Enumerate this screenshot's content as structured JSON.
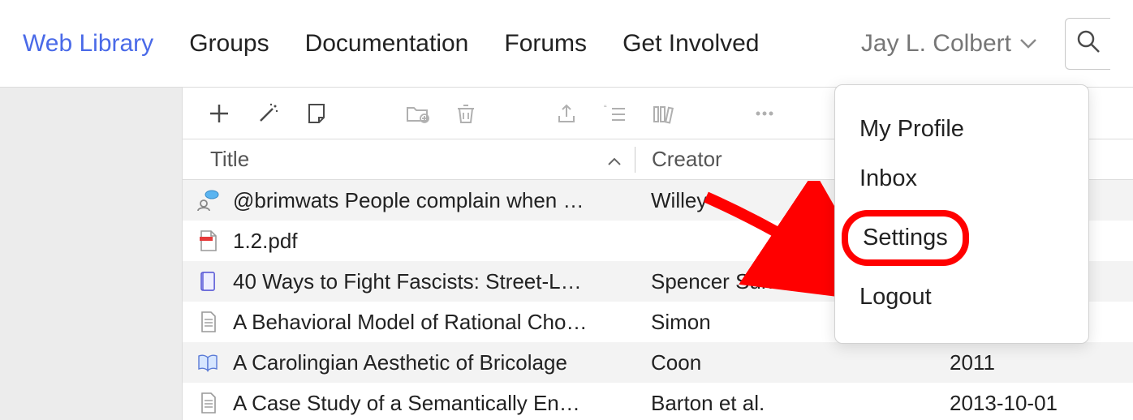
{
  "nav": {
    "links": [
      "Web Library",
      "Groups",
      "Documentation",
      "Forums",
      "Get Involved"
    ],
    "active_index": 0,
    "user_name": "Jay L. Colbert"
  },
  "user_menu": {
    "items": [
      "My Profile",
      "Inbox",
      "Settings",
      "Logout"
    ],
    "highlight_index": 2
  },
  "toolbar_icons": [
    "add-icon",
    "wand-icon",
    "note-icon",
    "folder-add-icon",
    "trash-icon",
    "export-icon",
    "citation-icon",
    "stacks-icon",
    "more-icon"
  ],
  "table": {
    "columns": {
      "title": "Title",
      "creator": "Creator"
    },
    "rows": [
      {
        "icon": "forum-post-icon",
        "title": "@brimwats People complain when …",
        "creator": "Willey",
        "date": ""
      },
      {
        "icon": "pdf-icon",
        "title": "1.2.pdf",
        "creator": "",
        "date": ""
      },
      {
        "icon": "book-icon",
        "title": "40 Ways to Fight Fascists: Street-L…",
        "creator": "Spencer Sunshine",
        "date": ""
      },
      {
        "icon": "doc-icon",
        "title": "A Behavioral Model of Rational Cho…",
        "creator": "Simon",
        "date": ""
      },
      {
        "icon": "book-open-icon",
        "title": "A Carolingian Aesthetic of Bricolage",
        "creator": "Coon",
        "date": "2011"
      },
      {
        "icon": "doc-icon",
        "title": "A Case Study of a Semantically En…",
        "creator": "Barton et al.",
        "date": "2013-10-01"
      }
    ]
  }
}
